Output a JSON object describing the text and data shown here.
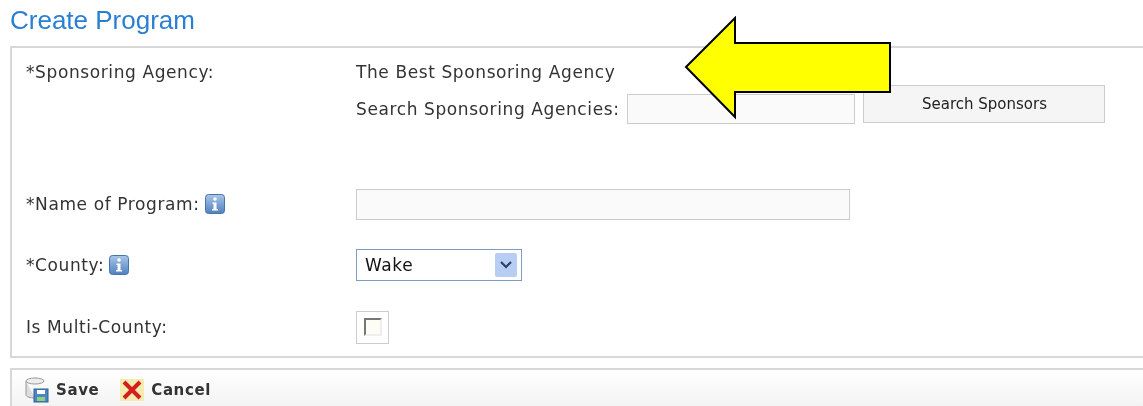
{
  "title": "Create Program",
  "fields": [
    {
      "kind": "value",
      "label": "*Sponsoring Agency:",
      "info": false,
      "value": "The Best Sponsoring Agency",
      "search_label": "Search Sponsoring Agencies:",
      "search_button": "Search Sponsors"
    },
    {
      "kind": "text",
      "label": "*Name of Program:",
      "info": true
    },
    {
      "kind": "select",
      "label": "*County:",
      "info": true,
      "value": "Wake"
    },
    {
      "kind": "checkbox",
      "label": "Is Multi-County:",
      "info": false,
      "checked": false
    }
  ],
  "toolbar": [
    {
      "kind": "save",
      "label": "Save"
    },
    {
      "kind": "cancel",
      "label": "Cancel"
    }
  ]
}
